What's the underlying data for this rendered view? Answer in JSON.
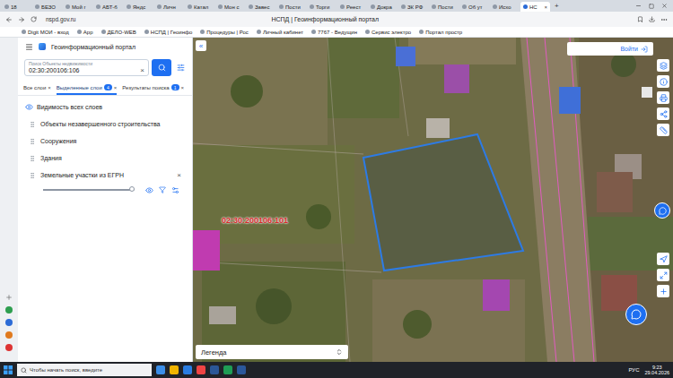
{
  "browser": {
    "tabs": [
      {
        "label": "18",
        "selected": false
      },
      {
        "label": "БЕЗО",
        "selected": false
      },
      {
        "label": "Мой г",
        "selected": false
      },
      {
        "label": "АБТ-б",
        "selected": false
      },
      {
        "label": "Яндс",
        "selected": false
      },
      {
        "label": "Личн",
        "selected": false
      },
      {
        "label": "Катал",
        "selected": false
      },
      {
        "label": "Мон с",
        "selected": false
      },
      {
        "label": "Завес",
        "selected": false
      },
      {
        "label": "Пости",
        "selected": false
      },
      {
        "label": "Торги",
        "selected": false
      },
      {
        "label": "Реест",
        "selected": false
      },
      {
        "label": "Докра",
        "selected": false
      },
      {
        "label": "ЗК РФ",
        "selected": false
      },
      {
        "label": "Пости",
        "selected": false
      },
      {
        "label": "Об ут",
        "selected": false
      },
      {
        "label": "Исхо",
        "selected": false
      },
      {
        "label": "НС",
        "selected": true
      }
    ],
    "tab_close": "×",
    "new_tab": "+",
    "address": "nspd.gov.ru",
    "page_title": "НСПД | Геоинформационный портал",
    "bookmarks": [
      "Digit МОИ - вход",
      "App",
      "ДЕЛО-WEB",
      "НСПД | Геоинфо",
      "Процедуры | Рос",
      "Личный кабинет",
      "7767 - Ведущин",
      "Сервис электро",
      "Портал простр"
    ]
  },
  "app": {
    "title": "Геоинформационный портал",
    "search": {
      "label": "Поиск Объекты недвижимости",
      "value": "02:30:200106:106",
      "clear": "×"
    },
    "tabs": [
      {
        "label": "Все слои",
        "badge": "",
        "selected": false
      },
      {
        "label": "Выделенные слои",
        "badge": "4",
        "selected": true
      },
      {
        "label": "Результаты поиска",
        "badge": "1",
        "selected": false
      }
    ],
    "tab_close": "×",
    "visibility_label": "Видимость всех слоев",
    "layers": [
      {
        "name": "Объекты незавершенного строительства",
        "expanded": false,
        "closable": false
      },
      {
        "name": "Сооружения",
        "expanded": false,
        "closable": false
      },
      {
        "name": "Здания",
        "expanded": false,
        "closable": false
      },
      {
        "name": "Земельные участки из ЕГРН",
        "expanded": true,
        "closable": true,
        "level": 0.97
      }
    ],
    "layer_close": "×"
  },
  "map": {
    "collapse": "«",
    "login": "Войти",
    "parcel_label": "02:30:200106:101",
    "legend": "Легенда"
  },
  "taskbar": {
    "search_placeholder": "Чтобы начать поиск, введите",
    "language": "РУС",
    "time": "9:23",
    "date": "29.04.2026"
  }
}
